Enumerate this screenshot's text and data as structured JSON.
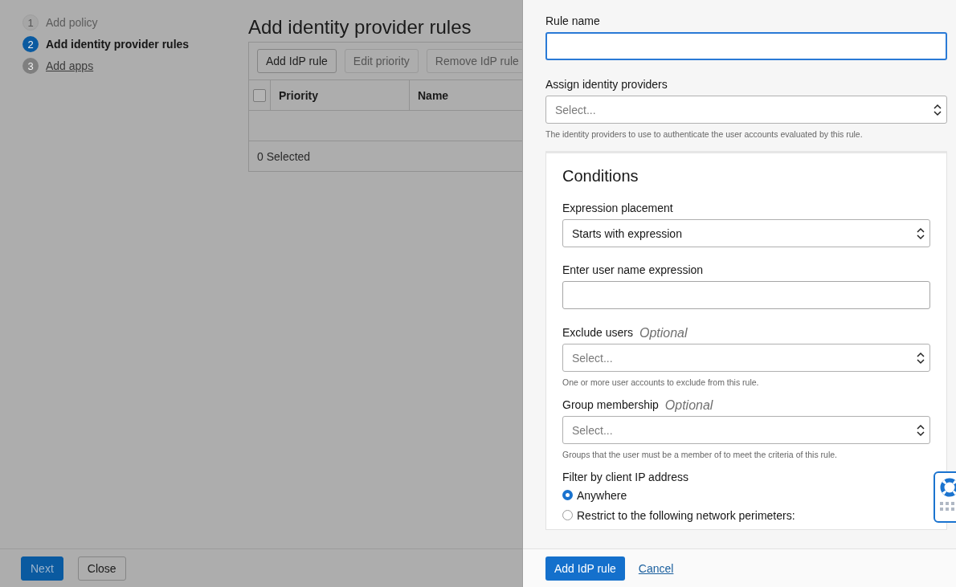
{
  "steps": [
    {
      "number": "1",
      "label": "Add policy",
      "kind": "disabled"
    },
    {
      "number": "2",
      "label": "Add identity provider rules",
      "kind": "current"
    },
    {
      "number": "3",
      "label": "Add apps",
      "kind": "link"
    }
  ],
  "page_title": "Add identity provider rules",
  "table_toolbar": [
    {
      "label": "Add IdP rule",
      "disabled": false
    },
    {
      "label": "Edit priority",
      "disabled": true
    },
    {
      "label": "Remove IdP rule",
      "disabled": true
    }
  ],
  "table": {
    "select_all_checked": false,
    "columns": [
      "Priority",
      "Name"
    ],
    "footer": "0 Selected"
  },
  "page_footer": [
    {
      "label": "Next",
      "kind": "primary"
    },
    {
      "label": "Close",
      "kind": "secondary"
    }
  ],
  "panel": {
    "fields": [
      {
        "kind": "input",
        "label": "Rule name",
        "focused": true
      },
      {
        "kind": "select",
        "label": "Assign identity providers",
        "placeholder": "Select...",
        "help": "The identity providers to use to authenticate the user accounts evaluated by this rule."
      }
    ],
    "conditions": {
      "title": "Conditions",
      "fields": [
        {
          "kind": "select",
          "label": "Expression placement",
          "value": "Starts with expression"
        },
        {
          "kind": "input",
          "label": "Enter user name expression",
          "focused": false
        },
        {
          "kind": "select",
          "label": "Exclude users",
          "optional": "Optional",
          "placeholder": "Select...",
          "help": "One or more user accounts to exclude from this rule."
        },
        {
          "kind": "select",
          "label": "Group membership",
          "optional": "Optional",
          "placeholder": "Select...",
          "help": "Groups that the user must be a member of to meet the criteria of this rule."
        },
        {
          "kind": "radio",
          "label": "Filter by client IP address",
          "options": [
            {
              "label": "Anywhere",
              "selected": true
            },
            {
              "label": "Restrict to the following network perimeters:",
              "selected": false
            }
          ]
        }
      ]
    },
    "submit": "Add IdP rule",
    "cancel": "Cancel"
  }
}
